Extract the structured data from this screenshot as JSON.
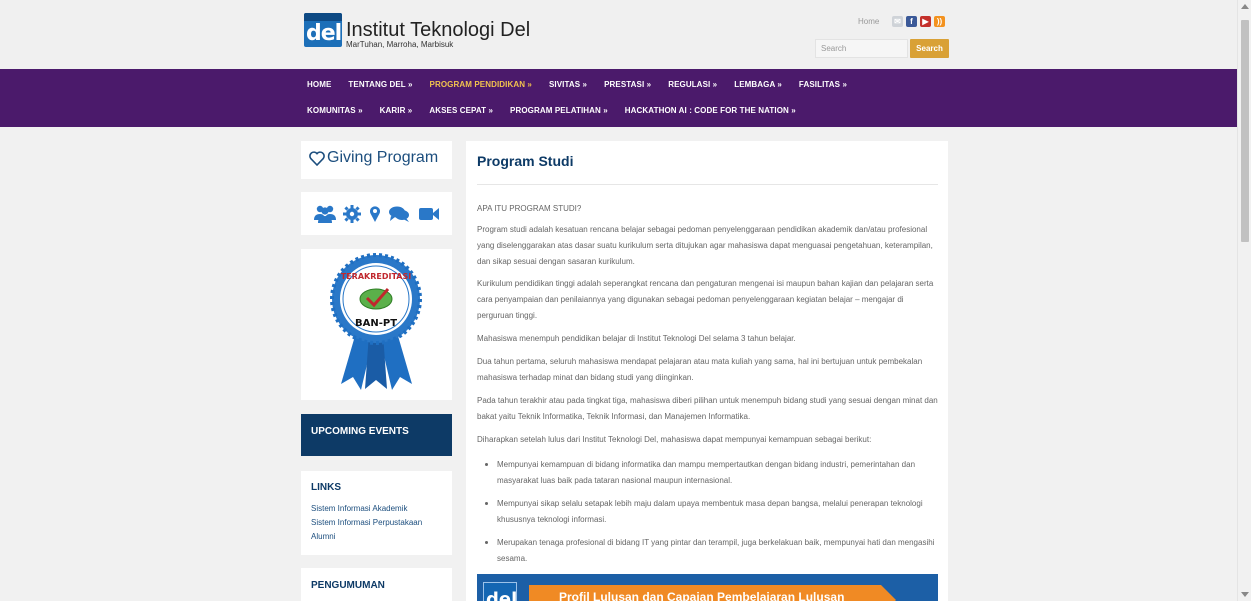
{
  "header": {
    "site_title": "Institut Teknologi Del",
    "site_subtitle": "MarTuhan, Marroha, Marbisuk",
    "logo_text": "del",
    "home_link": "Home",
    "search_placeholder": "Search",
    "search_button": "Search"
  },
  "nav": {
    "row1": [
      "HOME",
      "TENTANG DEL »",
      "PROGRAM PENDIDIKAN »",
      "SIVITAS »",
      "PRESTASI »",
      "REGULASI »",
      "LEMBAGA »",
      "FASILITAS »"
    ],
    "row2": [
      "KOMUNITAS »",
      "KARIR »",
      "AKSES CEPAT »",
      "PROGRAM PELATIHAN »",
      "HACKATHON AI : CODE FOR THE NATION »"
    ],
    "active": "PROGRAM PENDIDIKAN »"
  },
  "sidebar": {
    "giving_program": "Giving Program",
    "icons": [
      "users-icon",
      "gear-icon",
      "map-marker-icon",
      "comments-icon",
      "video-camera-icon"
    ],
    "badge_top": "TERAKREDITASI",
    "badge_bottom": "BAN-PT",
    "upcoming_events": "UPCOMING EVENTS",
    "links_title": "LINKS",
    "links": [
      "Sistem Informasi Akademik",
      "Sistem Informasi Perpustakaan",
      "Alumni"
    ],
    "pengumuman": "PENGUMUMAN"
  },
  "content": {
    "title": "Program Studi",
    "paragraphs": [
      "APA ITU PROGRAM STUDI?",
      "Program studi adalah kesatuan rencana belajar sebagai pedoman penyelenggaraan pendidikan akademik dan/atau profesional yang diselenggarakan atas dasar suatu kurikulum serta ditujukan agar mahasiswa dapat menguasai pengetahuan, keterampilan, dan sikap sesuai dengan sasaran kurikulum.",
      "Kurikulum pendidikan tinggi adalah seperangkat rencana dan pengaturan mengenai isi maupun bahan kajian dan pelajaran serta cara penyampaian dan penilaiannya yang digunakan sebagai pedoman penyelenggaraan kegiatan belajar – mengajar di perguruan tinggi.",
      "Mahasiswa menempuh pendidikan belajar di Institut Teknologi Del selama 3 tahun belajar.",
      "Dua tahun pertama, seluruh mahasiswa mendapat pelajaran atau mata kuliah yang sama, hal ini bertujuan untuk pembekalan mahasiswa terhadap minat dan bidang studi yang diinginkan.",
      "Pada tahun terakhir atau pada tingkat tiga, mahasiswa diberi pilihan untuk menempuh bidang studi yang sesuai dengan minat dan bakat yaitu Teknik Informatika, Teknik Informasi, dan Manajemen Informatika.",
      "Diharapkan setelah lulus dari Institut Teknologi Del, mahasiswa dapat mempunyai kemampuan sebagai berikut:"
    ],
    "bullets": [
      "Mempunyai kemampuan di bidang informatika dan mampu mempertautkan dengan bidang industri, pemerintahan dan masyarakat luas baik pada tataran nasional maupun internasional.",
      "Mempunyai sikap selalu setapak lebih maju dalam upaya membentuk masa depan bangsa, melalui penerapan teknologi khususnya teknologi informasi.",
      "Merupakan tenaga profesional di bidang IT yang pintar dan terampil, juga berkelakuan baik, mempunyai hati dan mengasihi sesama."
    ],
    "banner_logo": "del",
    "banner_text": "Profil Lulusan dan Capaian Pembelajaran Lulusan"
  }
}
